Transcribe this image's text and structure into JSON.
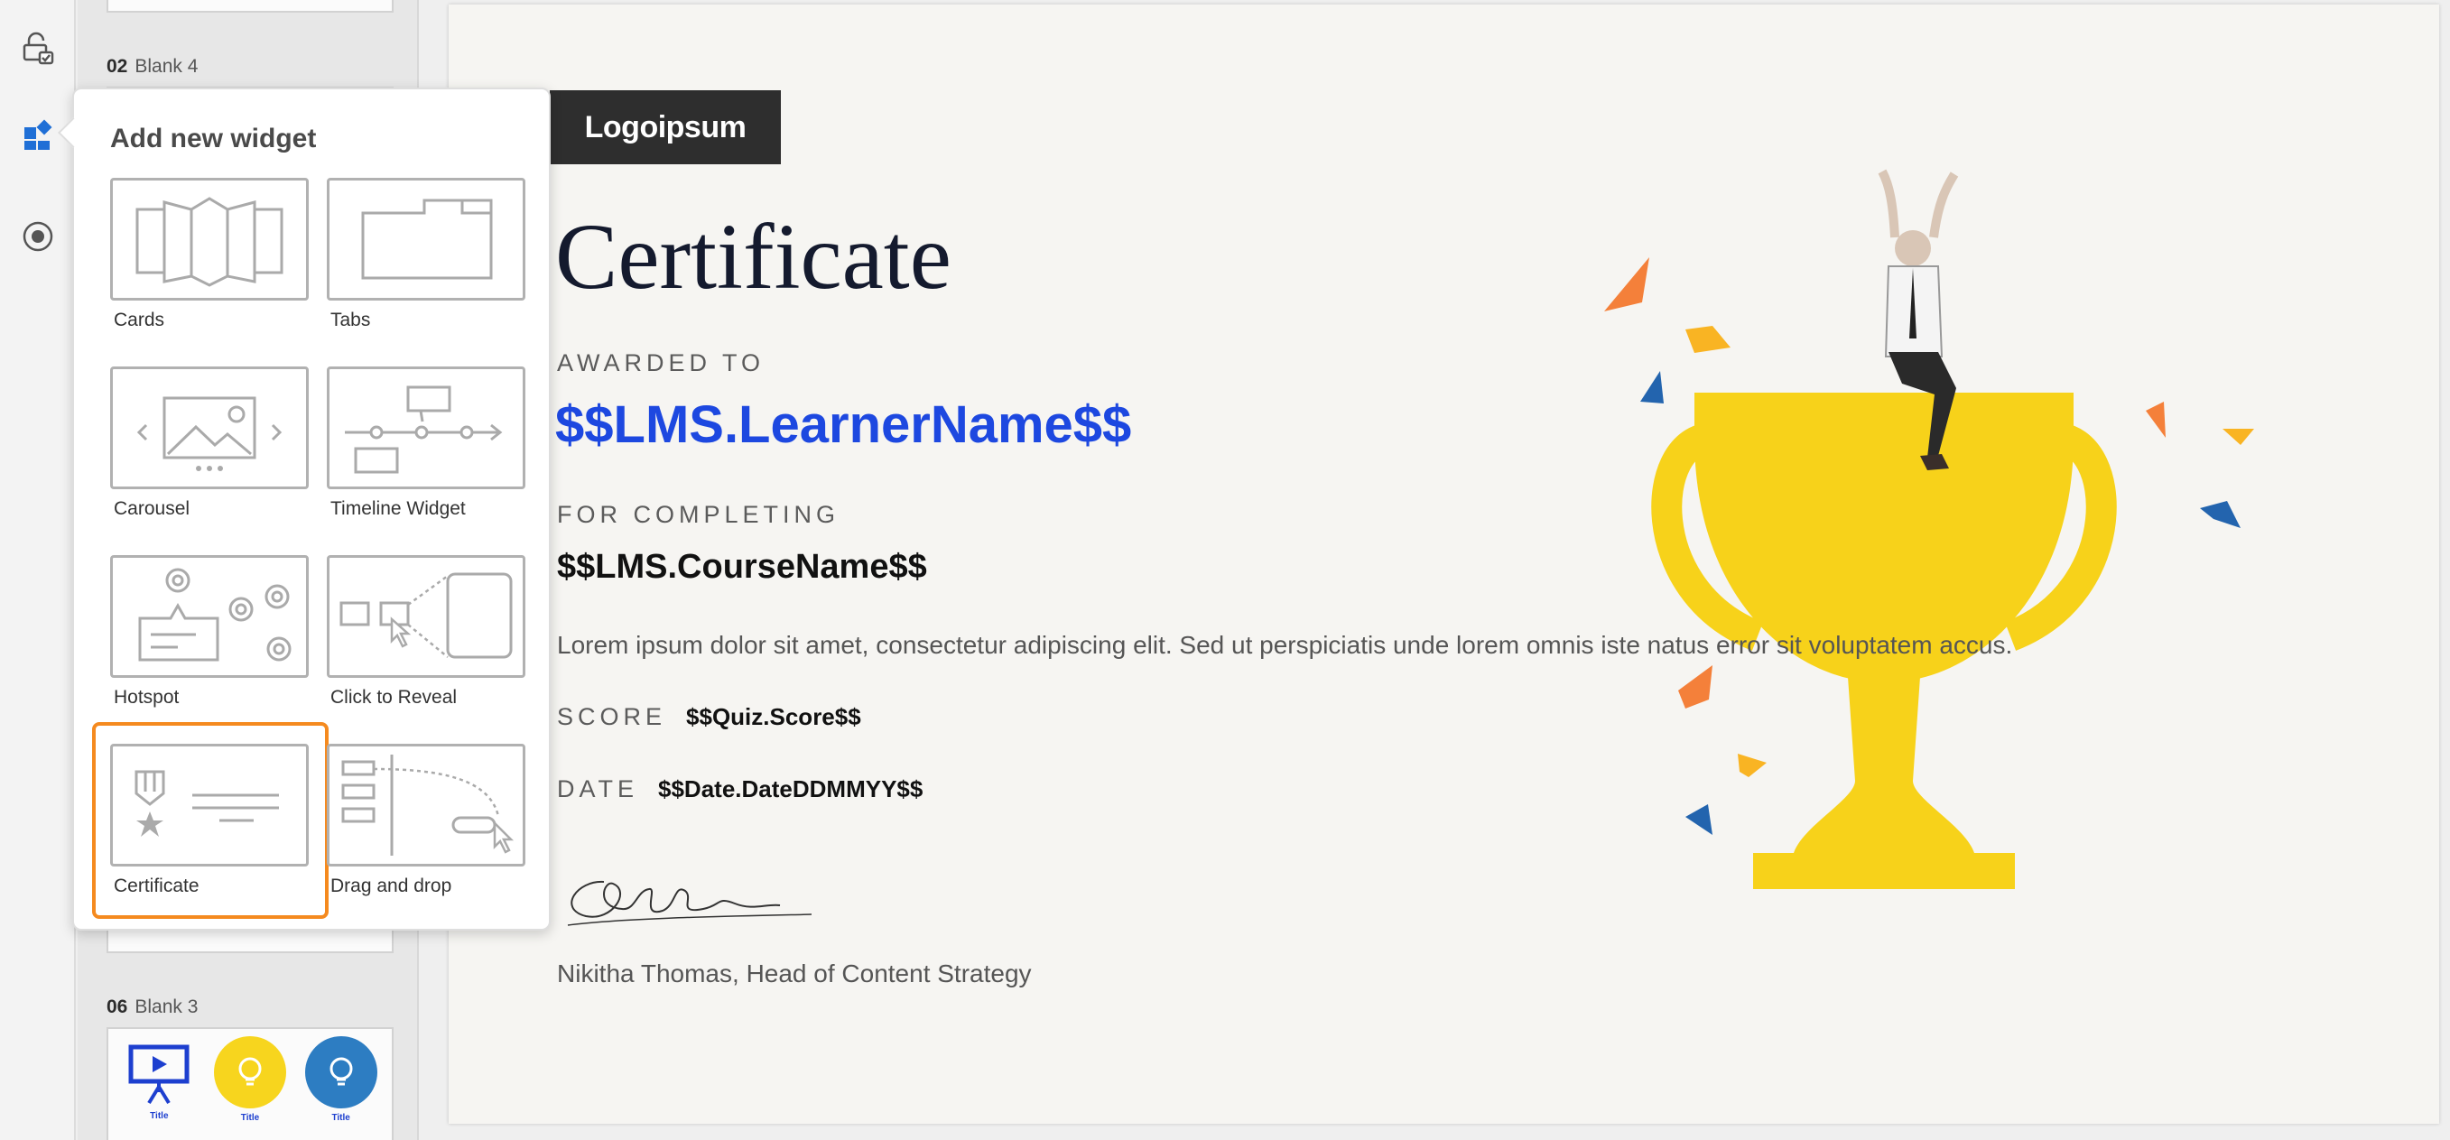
{
  "rail": {
    "icons": [
      "lock-check-icon",
      "widgets-icon",
      "record-icon"
    ]
  },
  "thumbnails": {
    "slide2": {
      "number": "02",
      "name": "Blank 4"
    },
    "slide6": {
      "number": "06",
      "name": "Blank 3",
      "cards": [
        {
          "title": "Title",
          "color": "#ffffff"
        },
        {
          "title": "Title",
          "color": "#f7d51e"
        },
        {
          "title": "Title",
          "color": "#2d7dc2"
        }
      ]
    }
  },
  "popover": {
    "title": "Add new widget",
    "widgets": [
      {
        "label": "Cards"
      },
      {
        "label": "Tabs"
      },
      {
        "label": "Carousel"
      },
      {
        "label": "Timeline Widget"
      },
      {
        "label": "Hotspot"
      },
      {
        "label": "Click to Reveal"
      },
      {
        "label": "Certificate"
      },
      {
        "label": "Drag and drop"
      }
    ],
    "selected": "Certificate"
  },
  "certificate": {
    "logo": "Logoipsum",
    "title": "Certificate",
    "awarded_to_label": "AWARDED TO",
    "learner_name": "$$LMS.LearnerName$$",
    "for_completing_label": "FOR COMPLETING",
    "course_name": "$$LMS.CourseName$$",
    "description": "Lorem ipsum dolor sit amet, consectetur adipiscing elit. Sed ut perspiciatis unde lorem omnis iste natus error sit voluptatem accus.",
    "score_label": "SCORE",
    "score_value": "$$Quiz.Score$$",
    "date_label": "DATE",
    "date_value": "$$Date.DateDDMMYY$$",
    "signer": "Nikitha Thomas, Head of Content Strategy"
  },
  "colors": {
    "accent_blue": "#1d48e0",
    "selection_orange": "#f58a1f",
    "trophy_yellow": "#f7d21a",
    "rail_active_blue": "#1f6fd6"
  }
}
